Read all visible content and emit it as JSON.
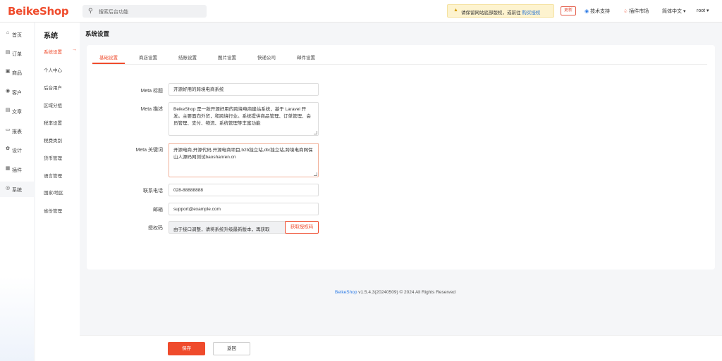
{
  "brand": {
    "logo": "BeikeShop"
  },
  "search": {
    "placeholder": "搜索后台功能"
  },
  "header": {
    "warning_text": "请保留网站底部版权，或前往 ",
    "warning_link": "购买授权",
    "update_badge": "更新",
    "support": "技术支持",
    "plugins": "插件市场",
    "language": "简体中文 ▾",
    "user": "root ▾"
  },
  "sidebar": {
    "items": [
      {
        "label": "首页",
        "icon": "home-icon"
      },
      {
        "label": "订单",
        "icon": "order-icon"
      },
      {
        "label": "商品",
        "icon": "product-icon"
      },
      {
        "label": "客户",
        "icon": "customer-icon"
      },
      {
        "label": "文章",
        "icon": "article-icon"
      },
      {
        "label": "报表",
        "icon": "report-icon"
      },
      {
        "label": "设计",
        "icon": "design-icon"
      },
      {
        "label": "插件",
        "icon": "plugin-icon"
      },
      {
        "label": "系统",
        "icon": "system-icon"
      }
    ]
  },
  "submenu": {
    "title": "系统",
    "items": [
      "系统设置",
      "个人中心",
      "后台用户",
      "区域分组",
      "税率设置",
      "税费类别",
      "货币管理",
      "语言管理",
      "国家/地区",
      "省份管理"
    ]
  },
  "page": {
    "title": "系统设置"
  },
  "tabs": [
    "基础设置",
    "商店设置",
    "结账设置",
    "图片设置",
    "快递公司",
    "邮件设置"
  ],
  "form": {
    "meta_title_label": "Meta 标题",
    "meta_title_value": "开源好用的跨境电商系统",
    "meta_desc_label": "Meta 描述",
    "meta_desc_value": "BeikeShop 是一款开源好用的跨境电商建站系统，基于 Laravel 开发。主要面向外贸，和跨境行业。系统提供商品管理、订单管理、会员管理、支付、物流、系统管理等丰富功能",
    "meta_keywords_label": "Meta 关键词",
    "meta_keywords_value": "开源电商,开源代码,开源电商项目,b2b独立站,dtc独立站,跨境电商网保山人源码网测试baoshanren.cn",
    "phone_label": "联系电话",
    "phone_value": "028-88888888",
    "email_label": "邮箱",
    "email_value": "support@example.com",
    "license_label": "授权码",
    "license_value": "由于接口调整，请将系统升级最新版本，再获取",
    "license_button": "获取授权码"
  },
  "footer": {
    "brand": "BeikeShop",
    "text": " v1.5.4.3(20240509) © 2024 All Rights Reserved"
  },
  "actions": {
    "save": "保存",
    "back": "返回"
  },
  "colors": {
    "accent": "#ef4b2c",
    "link": "#2d7be5",
    "warning_bg": "#fdf3cf"
  }
}
